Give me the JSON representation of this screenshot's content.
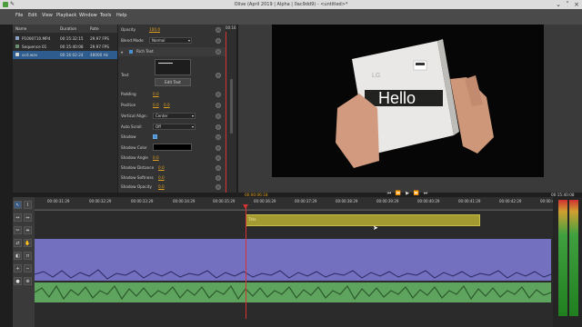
{
  "window": {
    "title": "Olive (April 2019 | Alpha | 0ac9dd9) - <untitled>*"
  },
  "menu": [
    "File",
    "Edit",
    "View",
    "Playback",
    "Window",
    "Tools",
    "Help"
  ],
  "project": {
    "columns": [
      "Name",
      "Duration",
      "Rate"
    ],
    "items": [
      {
        "name": "P1000710.MP4",
        "duration": "00:15:32:15",
        "rate": "29.97 FPS",
        "icon": "video-file-icon",
        "selected": false
      },
      {
        "name": "Sequence 01",
        "duration": "00:15:40:08",
        "rate": "29.97 FPS",
        "icon": "sequence-icon",
        "selected": false
      },
      {
        "name": "ocd.wav",
        "duration": "00:16:02:24",
        "rate": "48000 Hz",
        "icon": "audio-file-icon",
        "selected": true
      }
    ]
  },
  "effects": {
    "opacity_label": "Opacity",
    "opacity_value": "100.0",
    "blend_label": "Blend Mode",
    "blend_value": "Normal",
    "section": "Rich Text",
    "text_label": "Text",
    "edit_text_button": "Edit Text",
    "padding_label": "Padding",
    "padding_value": "0.0",
    "position_label": "Position",
    "position_x": "0.0",
    "position_y": "0.0",
    "valign_label": "Vertical Align:",
    "valign_value": "Center",
    "autoscroll_label": "Auto Scroll",
    "autoscroll_value": "Off",
    "shadow_label": "Shadow",
    "shadow_color_label": "Shadow Color",
    "shadow_angle_label": "Shadow Angle",
    "shadow_angle_value": "0.0",
    "shadow_distance_label": "Shadow Distance",
    "shadow_distance_value": "0.0",
    "shadow_softness_label": "Shadow Softness",
    "shadow_softness_value": "0.0",
    "shadow_opacity_label": "Shadow Opacity",
    "shadow_opacity_value": "0.0",
    "mini_timecode": "00:16"
  },
  "viewer": {
    "current_tc": "00:00:06:18",
    "end_tc": "00:15:40:08",
    "overlay_text": "Hello"
  },
  "timeline": {
    "ruler": [
      "00:00:31:29",
      "00:00:32:29",
      "00:00:33:29",
      "00:00:34:29",
      "00:00:35:29",
      "00:00:36:29",
      "00:00:37:29",
      "00:00:38:29",
      "00:00:39:29",
      "00:00:40:29",
      "00:00:41:29",
      "00:00:42:29",
      "00:00:43"
    ],
    "video_clip_label": "Title"
  },
  "colors": {
    "accent": "#e0a020",
    "playhead": "#d83232",
    "video_clip": "#a39a32",
    "audio_clip": "#7470c0",
    "audio_clip2": "#5ea45e"
  }
}
